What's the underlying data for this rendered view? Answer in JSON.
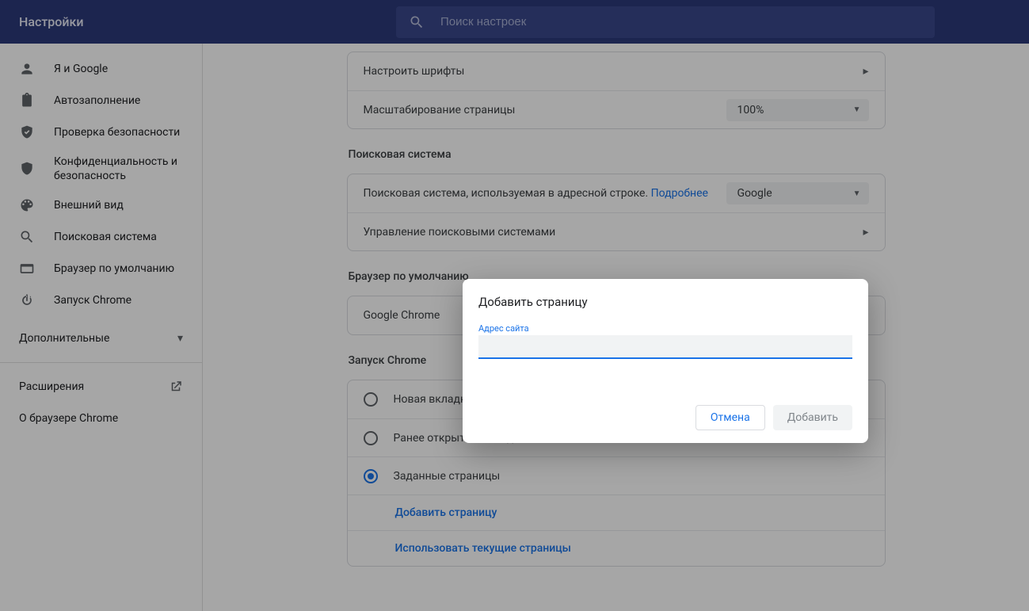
{
  "header": {
    "title": "Настройки",
    "search_placeholder": "Поиск настроек"
  },
  "sidebar": {
    "items": [
      {
        "label": "Я и Google"
      },
      {
        "label": "Автозаполнение"
      },
      {
        "label": "Проверка безопасности"
      },
      {
        "label": "Конфиденциальность и безопасность"
      },
      {
        "label": "Внешний вид"
      },
      {
        "label": "Поисковая система"
      },
      {
        "label": "Браузер по умолчанию"
      },
      {
        "label": "Запуск Chrome"
      }
    ],
    "advanced": "Дополнительные",
    "extensions": "Расширения",
    "about": "О браузере Chrome"
  },
  "main": {
    "fonts_row": "Настроить шрифты",
    "zoom_row": "Масштабирование страницы",
    "zoom_value": "100%",
    "search_section": "Поисковая система",
    "search_engine_text": "Поисковая система, используемая в адресной строке.",
    "search_engine_more": "Подробнее",
    "search_engine_value": "Google",
    "manage_engines": "Управление поисковыми системами",
    "default_browser_section": "Браузер по умолчанию",
    "default_browser_row": "Google Chrome",
    "startup_section": "Запуск Chrome",
    "radio_newtab": "Новая вкладка",
    "radio_continue": "Ранее открытые вкладки",
    "radio_specific": "Заданные страницы",
    "add_page": "Добавить страницу",
    "use_current": "Использовать текущие страницы"
  },
  "dialog": {
    "title": "Добавить страницу",
    "field_label": "Адрес сайта",
    "cancel": "Отмена",
    "add": "Добавить"
  }
}
